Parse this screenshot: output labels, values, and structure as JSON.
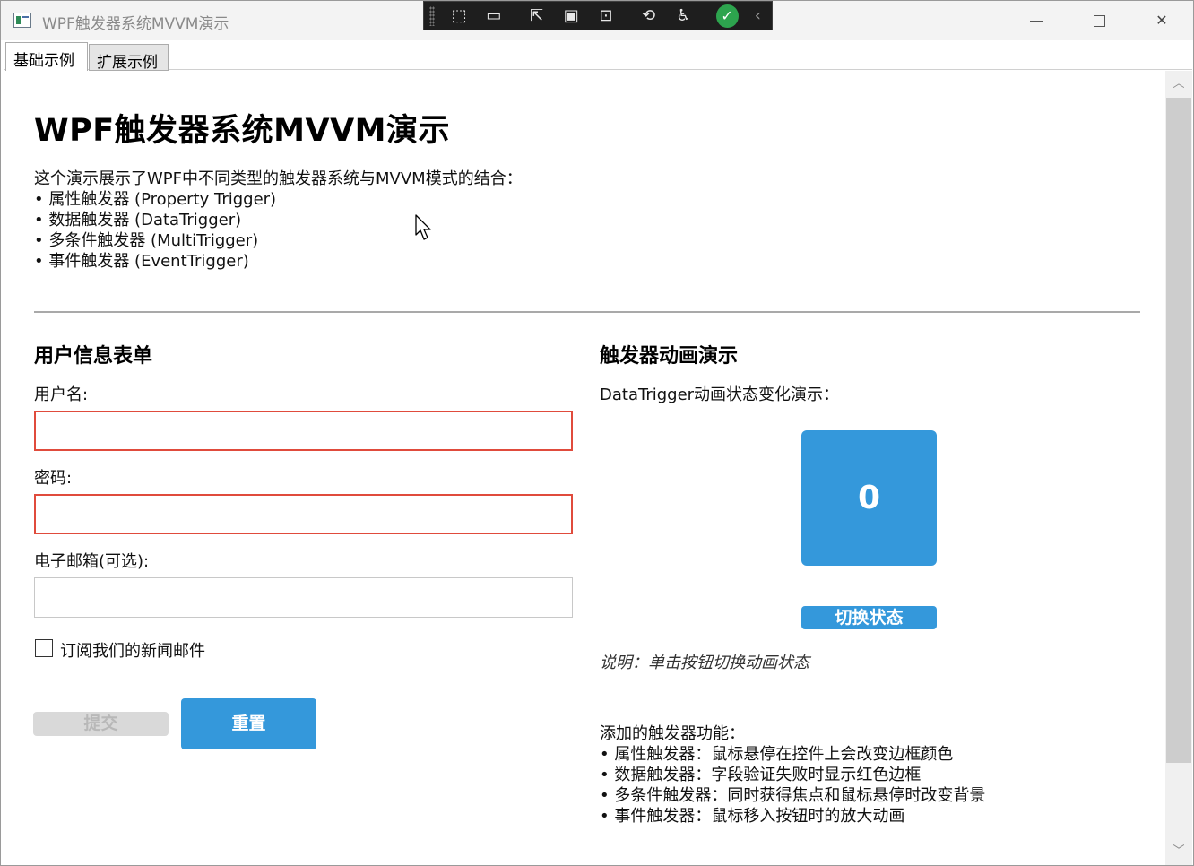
{
  "window": {
    "title": "WPF触发器系统MVVM演示",
    "minimize_icon": "minimize-icon",
    "maximize_icon": "maximize-icon",
    "close_icon": "close-icon",
    "close_glyph": "✕"
  },
  "debug_toolbar": {
    "items": [
      {
        "name": "select-element-icon",
        "glyph": "⬚"
      },
      {
        "name": "video-icon",
        "glyph": "▭"
      },
      {
        "name": "select-element-pointer-icon",
        "glyph": "⇱"
      },
      {
        "name": "display-layout-adorners-icon",
        "glyph": "▣"
      },
      {
        "name": "track-focused-element-icon",
        "glyph": "⊡"
      },
      {
        "name": "hot-reload-icon",
        "glyph": "⟲"
      },
      {
        "name": "accessibility-icon",
        "glyph": "♿"
      },
      {
        "name": "binding-ok-icon",
        "glyph": "✓"
      },
      {
        "name": "collapse-toolbar-icon",
        "glyph": "‹"
      }
    ]
  },
  "tabs": [
    {
      "label": "基础示例",
      "selected": true
    },
    {
      "label": "扩展示例",
      "selected": false
    }
  ],
  "page": {
    "title": "WPF触发器系统MVVM演示",
    "intro": [
      "这个演示展示了WPF中不同类型的触发器系统与MVVM模式的结合：",
      "• 属性触发器 (Property Trigger)",
      "• 数据触发器 (DataTrigger)",
      "• 多条件触发器 (MultiTrigger)",
      "• 事件触发器 (EventTrigger)"
    ]
  },
  "form": {
    "section_title": "用户信息表单",
    "username_label": "用户名:",
    "username_value": "",
    "password_label": "密码:",
    "password_value": "",
    "email_label": "电子邮箱(可选):",
    "email_value": "",
    "subscribe_label": "订阅我们的新闻邮件",
    "subscribe_checked": false,
    "submit_label": "提交",
    "reset_label": "重置",
    "error_border_color": "#e04b3c"
  },
  "animation": {
    "section_title": "触发器动画演示",
    "subtitle": "DataTrigger动画状态变化演示：",
    "box_value": "0",
    "toggle_label": "切换状态",
    "note": "说明：单击按钮切换动画状态",
    "accent_color": "#3498db",
    "features": [
      "添加的触发器功能：",
      "• 属性触发器：鼠标悬停在控件上会改变边框颜色",
      "• 数据触发器：字段验证失败时显示红色边框",
      "• 多条件触发器：同时获得焦点和鼠标悬停时改变背景",
      "• 事件触发器：鼠标移入按钮时的放大动画"
    ]
  },
  "scrollbar": {
    "up_glyph": "︿",
    "down_glyph": "﹀"
  }
}
